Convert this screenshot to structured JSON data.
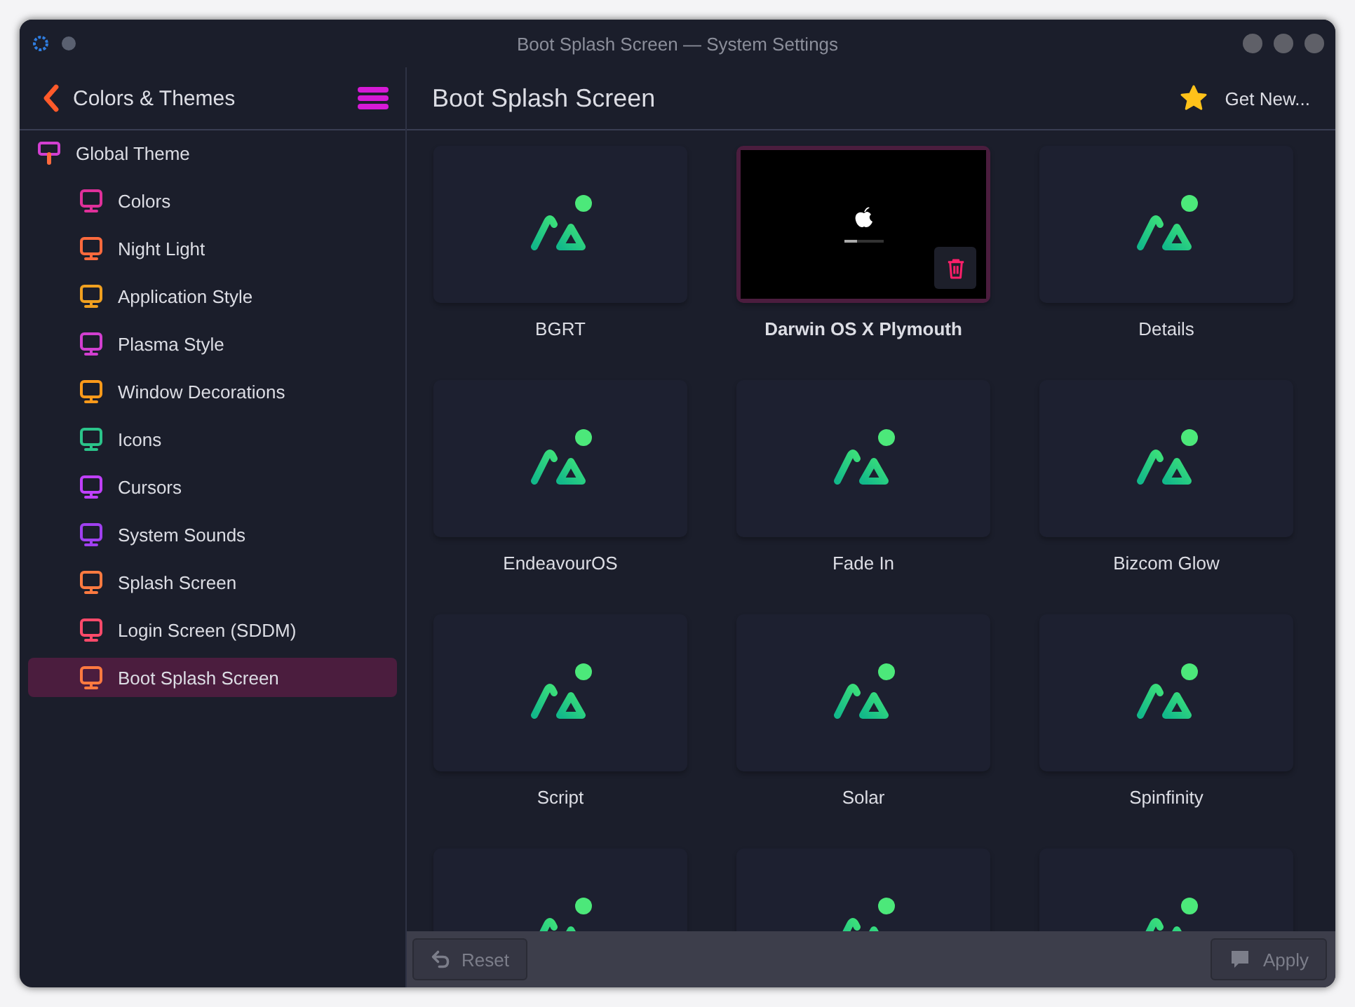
{
  "window": {
    "title": "Boot Splash Screen — System Settings"
  },
  "sidebar": {
    "back_label": "Colors & Themes",
    "items": [
      {
        "label": "Global Theme",
        "selected": false,
        "children": [
          {
            "label": "Colors",
            "selected": false
          },
          {
            "label": "Night Light",
            "selected": false
          },
          {
            "label": "Application Style",
            "selected": false
          },
          {
            "label": "Plasma Style",
            "selected": false
          },
          {
            "label": "Window Decorations",
            "selected": false
          },
          {
            "label": "Icons",
            "selected": false
          },
          {
            "label": "Cursors",
            "selected": false
          },
          {
            "label": "System Sounds",
            "selected": false
          },
          {
            "label": "Splash Screen",
            "selected": false
          },
          {
            "label": "Login Screen (SDDM)",
            "selected": false
          },
          {
            "label": "Boot Splash Screen",
            "selected": true
          }
        ]
      }
    ]
  },
  "page": {
    "title": "Boot Splash Screen",
    "get_new_label": "Get New..."
  },
  "themes": [
    {
      "label": "BGRT",
      "kind": "placeholder",
      "selected": false
    },
    {
      "label": "Darwin OS X Plymouth",
      "kind": "preview",
      "selected": true
    },
    {
      "label": "Details",
      "kind": "placeholder",
      "selected": false
    },
    {
      "label": "EndeavourOS",
      "kind": "placeholder",
      "selected": false
    },
    {
      "label": "Fade In",
      "kind": "placeholder",
      "selected": false
    },
    {
      "label": "Bizcom Glow",
      "kind": "placeholder",
      "selected": false
    },
    {
      "label": "Script",
      "kind": "placeholder",
      "selected": false
    },
    {
      "label": "Solar",
      "kind": "placeholder",
      "selected": false
    },
    {
      "label": "Spinfinity",
      "kind": "placeholder",
      "selected": false
    },
    {
      "kind": "placeholder",
      "selected": false
    },
    {
      "kind": "placeholder",
      "selected": false
    },
    {
      "kind": "placeholder",
      "selected": false
    }
  ],
  "footer": {
    "buttons": [
      {
        "label": "Reset",
        "kind": "reset",
        "disabled": true
      },
      {
        "label": "Apply",
        "kind": "apply",
        "disabled": true
      }
    ]
  }
}
